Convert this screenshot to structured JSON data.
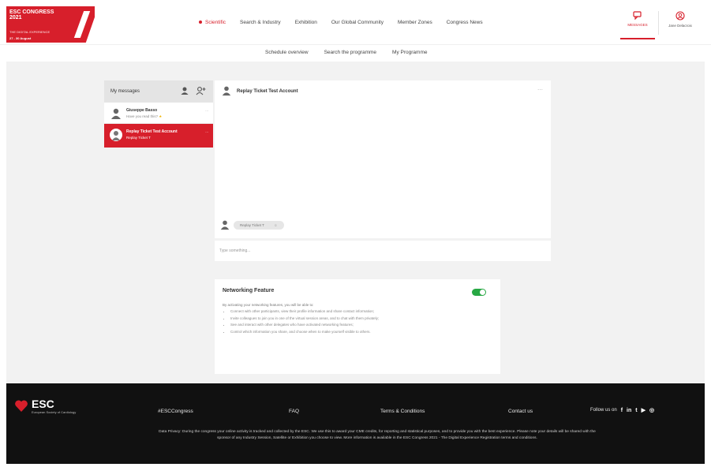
{
  "header": {
    "logo_line1": "ESC CONGRESS 2021",
    "logo_line2": "THE DIGITAL EXPERIENCE",
    "logo_line3": "27 - 30 August",
    "nav": [
      {
        "label": "Scientific",
        "active": true
      },
      {
        "label": "Search & Industry",
        "active": false
      },
      {
        "label": "Exhibition",
        "active": false
      },
      {
        "label": "Our Global Community",
        "active": false
      },
      {
        "label": "Member Zones",
        "active": false
      },
      {
        "label": "Congress News",
        "active": false
      }
    ],
    "messages_label": "MESSAGES",
    "user_label": "Jane Delacroix"
  },
  "subnav": {
    "items": [
      "Schedule overview",
      "Search the programme",
      "My Programme"
    ]
  },
  "conversations": {
    "title": "My messages",
    "items": [
      {
        "name": "Giuseppe Basso",
        "preview": "Have you read this?",
        "time": "...",
        "selected": false
      },
      {
        "name": "Replay Ticket Test Account",
        "preview": "Replay Ticket T",
        "time": "...",
        "selected": true
      }
    ]
  },
  "chat": {
    "contact_name": "Replay Ticket Test Account",
    "message_preview": "Replay Ticket T",
    "input_placeholder": "Type something..."
  },
  "networking": {
    "title": "Networking Feature",
    "enabled": true,
    "intro": "By activating your networking features, you will be able to:",
    "bullets": [
      "Connect with other participants, view their profile information and share contact information;",
      "Invite colleagues to join you in one of the virtual session areas, and to chat with them privately;",
      "See and interact with other delegates who have activated networking features;",
      "Control which information you share, and choose when to make yourself visible to others."
    ]
  },
  "footer": {
    "logo_name": "ESC",
    "logo_sub": "European Society of Cardiology",
    "links": [
      "#ESCCongress",
      "FAQ",
      "Terms & Conditions",
      "Contact us"
    ],
    "follow_label": "Follow us on",
    "social_icons": [
      "f",
      "in",
      "t",
      "▶",
      "◎"
    ],
    "privacy_text": "Data Privacy: During the congress your online activity is tracked and collected by the ESC. We use this to award your CME credits, for reporting and statistical purposes, and to provide you with the best experience. Please note your details will be shared with the sponsor of any Industry Session, Satellite or Exhibition you choose to view. More information is available in the ESC Congress 2021 - The Digital Experience Registration terms and conditions."
  }
}
